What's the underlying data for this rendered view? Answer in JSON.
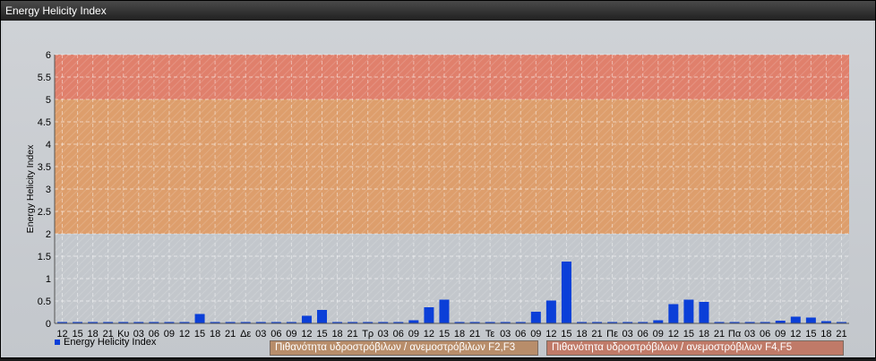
{
  "window": {
    "title": "Energy Helicity Index"
  },
  "legend": {
    "series_label": "Energy Helicity Index"
  },
  "bands": [
    {
      "label": "Πιθανότητα υδροστρόβιλων / ανεμοστρόβιλων F2,F3",
      "from": 2,
      "to": 5,
      "color": "#dd9e6c"
    },
    {
      "label": "Πιθανότητα υδροστρόβιλων / ανεμοστρόβιλων F4,F5",
      "from": 5,
      "to": 6,
      "color": "#e0806c"
    }
  ],
  "colors": {
    "bar": "#0b3fd8",
    "low_band": "#c3c7cc"
  },
  "chart_data": {
    "type": "bar",
    "title": "",
    "xlabel": "",
    "ylabel": "Energy Helicity Index",
    "ylim": [
      0,
      6
    ],
    "yticks": [
      "0",
      "0.5",
      "1",
      "1.5",
      "2",
      "2.5",
      "3",
      "3.5",
      "4",
      "4.5",
      "5",
      "5.5",
      "6"
    ],
    "grid": true,
    "legend_position": "bottom-left",
    "categories": [
      "12",
      "15",
      "18",
      "21",
      "Κυ",
      "03",
      "06",
      "09",
      "12",
      "15",
      "18",
      "21",
      "Δε",
      "03",
      "06",
      "09",
      "12",
      "15",
      "18",
      "21",
      "Τρ",
      "03",
      "06",
      "09",
      "12",
      "15",
      "18",
      "21",
      "Τε",
      "03",
      "06",
      "09",
      "12",
      "15",
      "18",
      "21",
      "Πε",
      "03",
      "06",
      "09",
      "12",
      "15",
      "18",
      "21",
      "Πα",
      "03",
      "06",
      "09",
      "12",
      "15",
      "18",
      "21"
    ],
    "series": [
      {
        "name": "Energy Helicity Index",
        "values": [
          0.01,
          0.01,
          0.01,
          0.01,
          0.01,
          0.01,
          0.01,
          0.01,
          0.01,
          0.21,
          0.01,
          0.01,
          0.01,
          0.01,
          0.01,
          0.01,
          0.17,
          0.3,
          0.01,
          0.01,
          0.01,
          0.01,
          0.01,
          0.07,
          0.36,
          0.53,
          0.02,
          0.01,
          0.01,
          0.01,
          0.01,
          0.26,
          0.51,
          1.38,
          0.03,
          0.01,
          0.01,
          0.01,
          0.01,
          0.07,
          0.43,
          0.53,
          0.48,
          0.01,
          0.01,
          0.01,
          0.01,
          0.06,
          0.15,
          0.13,
          0.05,
          0.02
        ]
      }
    ]
  }
}
